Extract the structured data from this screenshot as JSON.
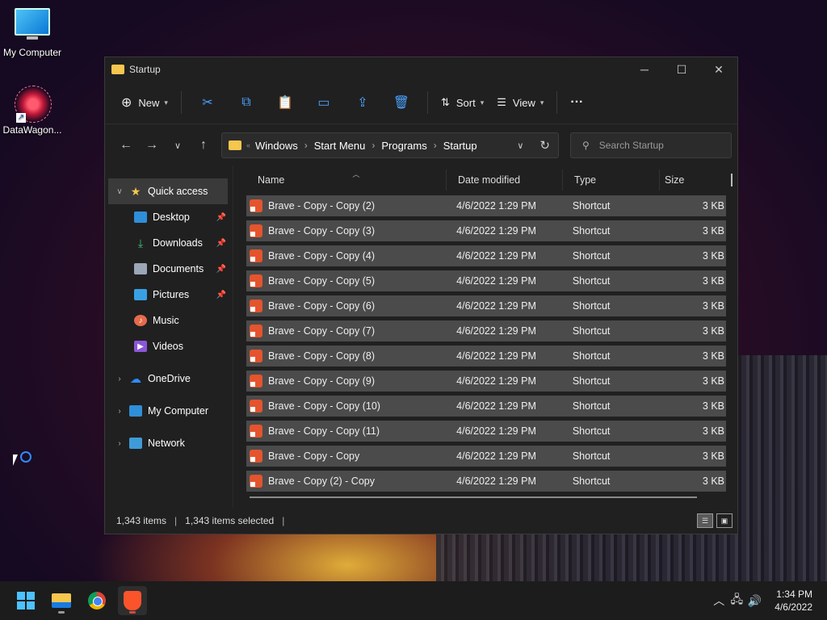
{
  "desktop": {
    "icons": [
      {
        "label": "My Computer",
        "icon": "monitor-icon"
      },
      {
        "label": "DataWagon...",
        "icon": "datawagon-icon"
      }
    ]
  },
  "window": {
    "title": "Startup",
    "toolbar": {
      "new_label": "New",
      "sort_label": "Sort",
      "view_label": "View",
      "more_label": "···"
    },
    "breadcrumb": [
      "Windows",
      "Start Menu",
      "Programs",
      "Startup"
    ],
    "search_placeholder": "Search Startup",
    "nav": {
      "quick_access": "Quick access",
      "pinned": [
        "Desktop",
        "Downloads",
        "Documents",
        "Pictures"
      ],
      "unpinned": [
        "Music",
        "Videos"
      ],
      "onedrive": "OneDrive",
      "my_computer": "My Computer",
      "network": "Network"
    },
    "columns": {
      "name": "Name",
      "date": "Date modified",
      "type": "Type",
      "size": "Size"
    },
    "rows": [
      {
        "name": "Brave - Copy - Copy (2)",
        "date": "4/6/2022 1:29 PM",
        "type": "Shortcut",
        "size": "3 KB"
      },
      {
        "name": "Brave - Copy - Copy (3)",
        "date": "4/6/2022 1:29 PM",
        "type": "Shortcut",
        "size": "3 KB"
      },
      {
        "name": "Brave - Copy - Copy (4)",
        "date": "4/6/2022 1:29 PM",
        "type": "Shortcut",
        "size": "3 KB"
      },
      {
        "name": "Brave - Copy - Copy (5)",
        "date": "4/6/2022 1:29 PM",
        "type": "Shortcut",
        "size": "3 KB"
      },
      {
        "name": "Brave - Copy - Copy (6)",
        "date": "4/6/2022 1:29 PM",
        "type": "Shortcut",
        "size": "3 KB"
      },
      {
        "name": "Brave - Copy - Copy (7)",
        "date": "4/6/2022 1:29 PM",
        "type": "Shortcut",
        "size": "3 KB"
      },
      {
        "name": "Brave - Copy - Copy (8)",
        "date": "4/6/2022 1:29 PM",
        "type": "Shortcut",
        "size": "3 KB"
      },
      {
        "name": "Brave - Copy - Copy (9)",
        "date": "4/6/2022 1:29 PM",
        "type": "Shortcut",
        "size": "3 KB"
      },
      {
        "name": "Brave - Copy - Copy (10)",
        "date": "4/6/2022 1:29 PM",
        "type": "Shortcut",
        "size": "3 KB"
      },
      {
        "name": "Brave - Copy - Copy (11)",
        "date": "4/6/2022 1:29 PM",
        "type": "Shortcut",
        "size": "3 KB"
      },
      {
        "name": "Brave - Copy - Copy",
        "date": "4/6/2022 1:29 PM",
        "type": "Shortcut",
        "size": "3 KB"
      },
      {
        "name": "Brave - Copy (2) - Copy",
        "date": "4/6/2022 1:29 PM",
        "type": "Shortcut",
        "size": "3 KB"
      }
    ],
    "status": {
      "items": "1,343 items",
      "selected": "1,343 items selected"
    }
  },
  "taskbar": {
    "apps": [
      "start-icon",
      "file-explorer-icon",
      "chrome-icon",
      "brave-icon"
    ],
    "time": "1:34 PM",
    "date": "4/6/2022"
  },
  "colors": {
    "accent": "#4aa3ff",
    "window_bg": "#202020",
    "row_selected": "#4b4b4b"
  }
}
